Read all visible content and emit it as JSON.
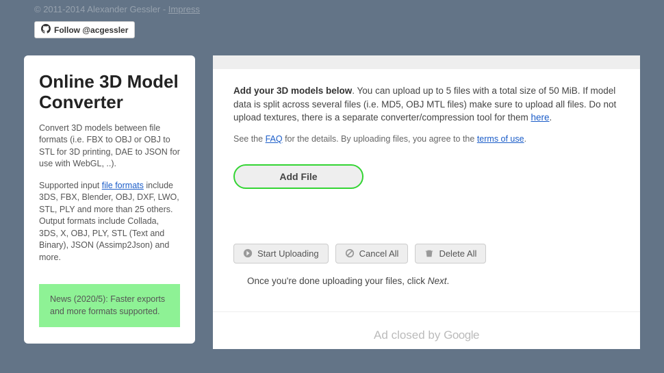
{
  "topbar": {
    "copyright": "© 2011-2014 Alexander Gessler - ",
    "impress": "Impress"
  },
  "follow": {
    "label": "Follow @acgessler"
  },
  "sidebar": {
    "title": "Online 3D Model Converter",
    "p1": "Convert 3D models between file formats (i.e. FBX to OBJ or OBJ to STL for 3D printing, DAE to JSON for use with WebGL, ..).",
    "p2a": "Supported input ",
    "p2link": "file formats",
    "p2b": " include 3DS, FBX, Blender, OBJ, DXF, LWO, STL, PLY and more than 25 others. Output formats include Collada, 3DS, X, OBJ, PLY, STL (Text and Binary), JSON (Assimp2Json) and more.",
    "news": "News (2020/5): Faster exports and more formats supported."
  },
  "main": {
    "instr_bold": "Add your 3D models below",
    "instr_a": ". You can upload up to 5 files with a total size of 50 MiB. If model data is split across several files (i.e. MD5, OBJ MTL files) make sure to upload all files. Do not upload textures, there is a separate converter/compression tool for them ",
    "instr_here": "here",
    "instr_dot": ".",
    "faq_a": "See the ",
    "faq_link": "FAQ",
    "faq_b": " for the details. By uploading files, you agree to the ",
    "faq_terms": "terms of use",
    "faq_dot": ".",
    "addfile": "Add File",
    "start": "Start Uploading",
    "cancel": "Cancel All",
    "delete": "Delete All",
    "done_a": "Once you're done uploading your files, click ",
    "done_b": "Next",
    "done_c": "."
  },
  "ad": {
    "text": "Ad closed by ",
    "brand": "Google"
  }
}
